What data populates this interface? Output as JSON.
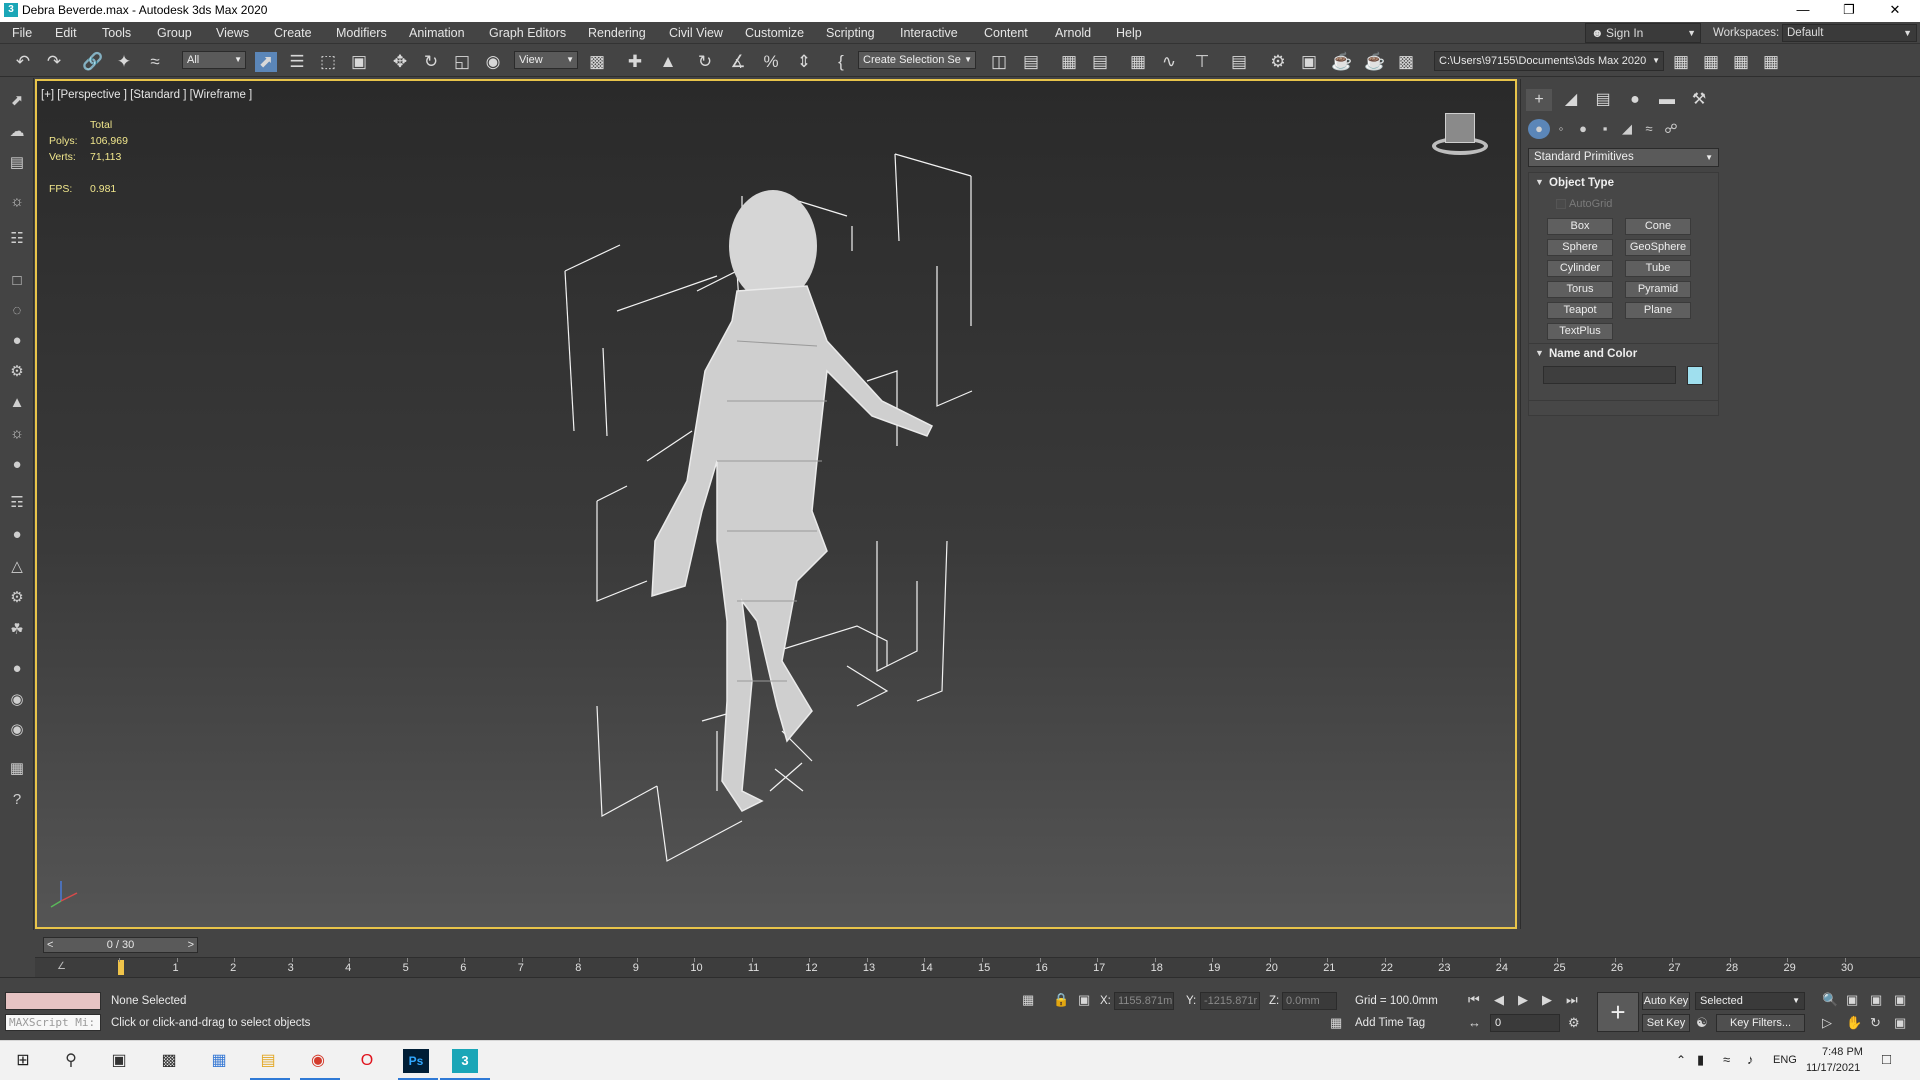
{
  "window": {
    "title": "Debra Beverde.max - Autodesk 3ds Max 2020",
    "minimize_icon": "minimize-icon",
    "maximize_icon": "restore-icon",
    "close_icon": "close-icon"
  },
  "menu": {
    "items": [
      "File",
      "Edit",
      "Tools",
      "Group",
      "Views",
      "Create",
      "Modifiers",
      "Animation",
      "Graph Editors",
      "Rendering",
      "Civil View",
      "Customize",
      "Scripting",
      "Interactive",
      "Content",
      "Arnold",
      "Help"
    ],
    "sign_in": "Sign In",
    "workspaces_label": "Workspaces:",
    "workspaces_value": "Default"
  },
  "toolbar": {
    "selection_filter": "All",
    "ref_coord": "View",
    "named_selection": "Create Selection Se",
    "project_path": "C:\\Users\\97155\\Documents\\3ds Max 2020"
  },
  "viewport": {
    "label": "[+] [Perspective ] [Standard ] [Wireframe ]",
    "stats": {
      "total_label": "Total",
      "polys_label": "Polys:",
      "polys_value": "106,969",
      "verts_label": "Verts:",
      "verts_value": "71,113",
      "fps_label": "FPS:",
      "fps_value": "0.981"
    }
  },
  "command_panel": {
    "category": "Standard Primitives",
    "object_type": {
      "title": "Object Type",
      "autogrid": "AutoGrid",
      "buttons": [
        "Box",
        "Cone",
        "Sphere",
        "GeoSphere",
        "Cylinder",
        "Tube",
        "Torus",
        "Pyramid",
        "Teapot",
        "Plane",
        "TextPlus"
      ]
    },
    "name_color": {
      "title": "Name and Color",
      "name_value": "",
      "swatch_color": "#9fdfee"
    }
  },
  "timeline": {
    "slider": "0 / 30",
    "ticks": [
      "0",
      "1",
      "2",
      "3",
      "4",
      "5",
      "6",
      "7",
      "8",
      "9",
      "10",
      "11",
      "12",
      "13",
      "14",
      "15",
      "16",
      "17",
      "18",
      "19",
      "20",
      "21",
      "22",
      "23",
      "24",
      "25",
      "26",
      "27",
      "28",
      "29",
      "30"
    ],
    "current_frame": 0
  },
  "status": {
    "maxscript_placeholder": "MAXScript Mi:",
    "selection_status": "None Selected",
    "prompt": "Click or click-and-drag to select objects",
    "x_label": "X:",
    "x_value": "1155.871m",
    "y_label": "Y:",
    "y_value": "-1215.871r",
    "z_label": "Z:",
    "z_value": "0.0mm",
    "grid": "Grid = 100.0mm",
    "add_time_tag": "Add Time Tag",
    "auto_key": "Auto Key",
    "selected": "Selected",
    "set_key": "Set Key",
    "key_filters": "Key Filters...",
    "frame_value": "0"
  },
  "taskbar": {
    "language": "ENG",
    "time": "7:48 PM",
    "date": "11/17/2021",
    "ps_label": "Ps",
    "max_label": "3"
  }
}
